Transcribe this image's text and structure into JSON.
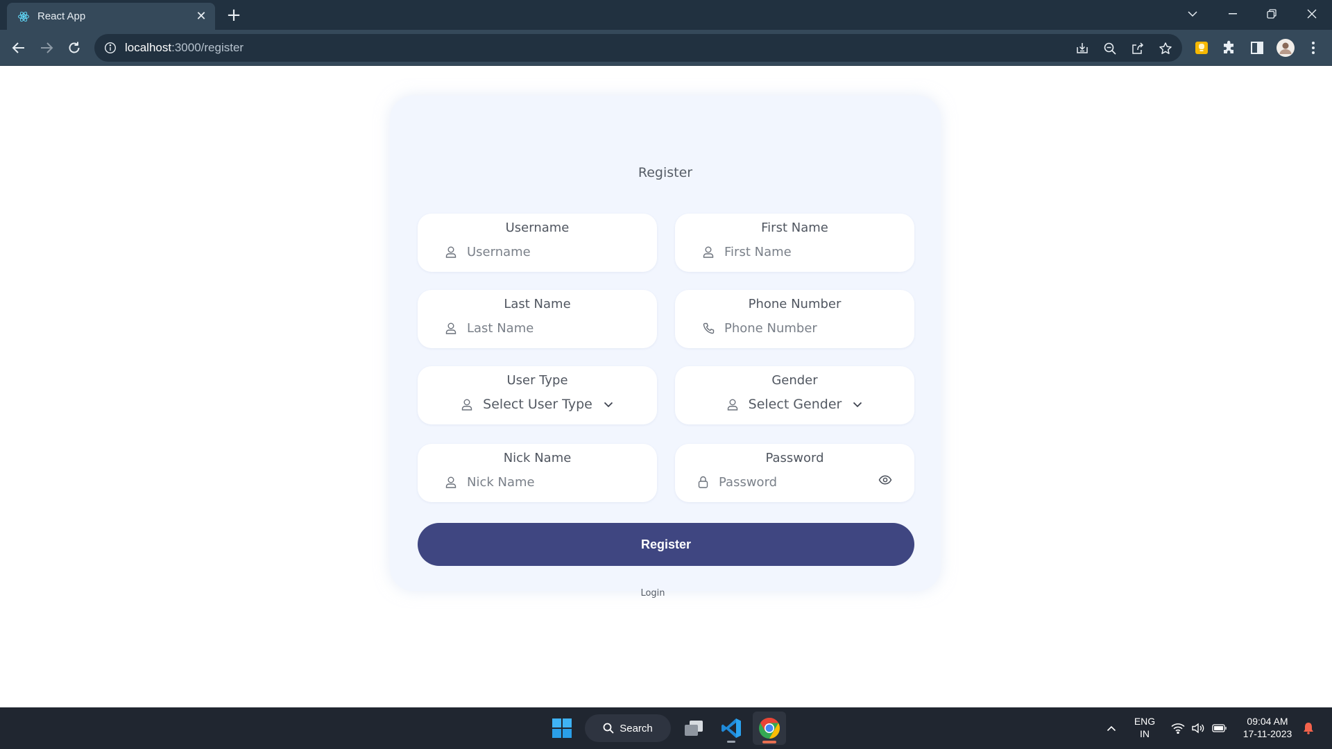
{
  "browser": {
    "tab_title": "React App",
    "url_host": "localhost",
    "url_path": ":3000/register"
  },
  "form": {
    "title": "Register",
    "fields": {
      "username": {
        "label": "Username",
        "placeholder": "Username"
      },
      "first_name": {
        "label": "First Name",
        "placeholder": "First Name"
      },
      "last_name": {
        "label": "Last Name",
        "placeholder": "Last Name"
      },
      "phone": {
        "label": "Phone Number",
        "placeholder": "Phone Number"
      },
      "user_type": {
        "label": "User Type",
        "selected": "Select User Type"
      },
      "gender": {
        "label": "Gender",
        "selected": "Select Gender"
      },
      "nick_name": {
        "label": "Nick Name",
        "placeholder": "Nick Name"
      },
      "password": {
        "label": "Password",
        "placeholder": "Password"
      }
    },
    "submit_label": "Register",
    "login_link": "Login"
  },
  "taskbar": {
    "search_label": "Search",
    "lang_line1": "ENG",
    "lang_line2": "IN",
    "time": "09:04 AM",
    "date": "17-11-2023"
  },
  "colors": {
    "accent_button": "#3f4681",
    "card_background": "#f2f6fe",
    "chrome_dark": "#213140"
  }
}
